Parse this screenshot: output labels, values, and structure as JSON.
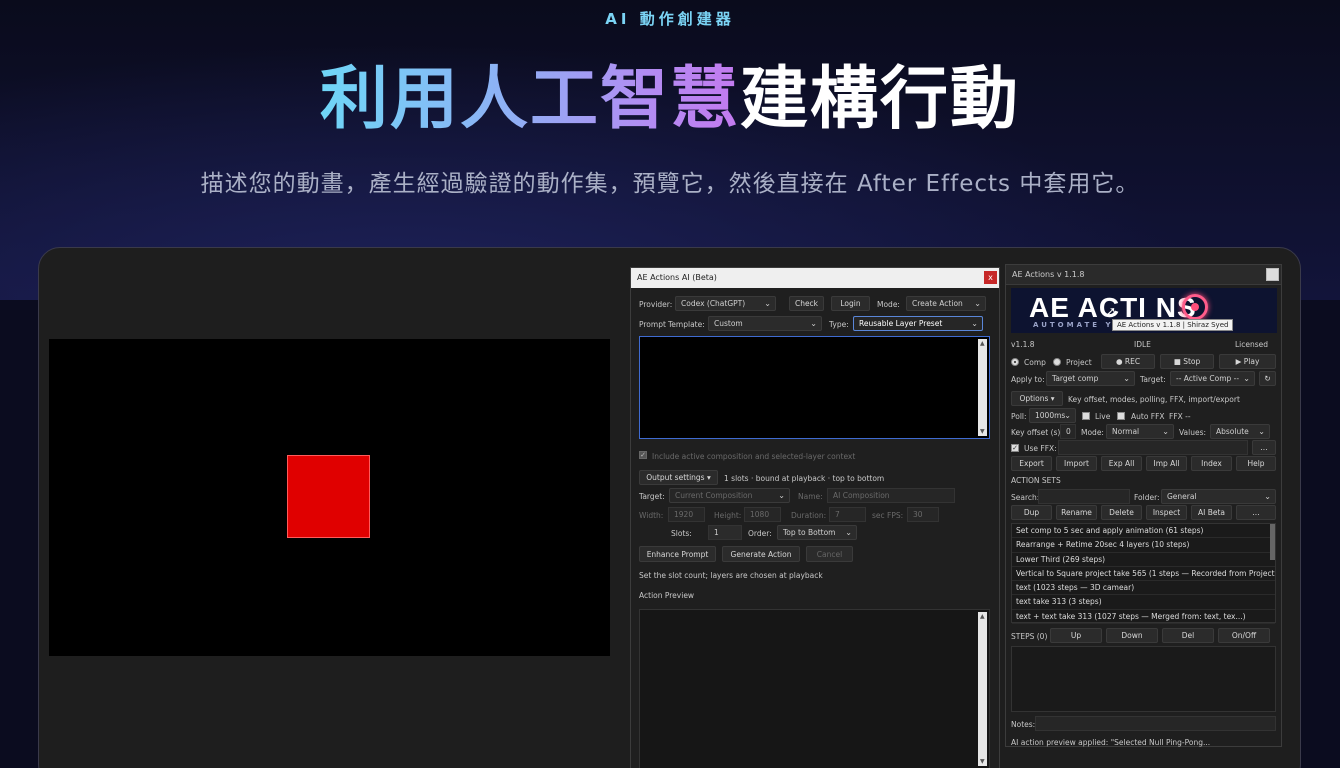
{
  "hero": {
    "eyebrow": "AI 動作創建器",
    "headline_gradient": "利用人工智慧",
    "headline_white": "建構行動",
    "subline": "描述您的動畫，產生經過驗證的動作集，預覽它，然後直接在 After Effects 中套用它。"
  },
  "ai_panel": {
    "title": "AE Actions AI (Beta)",
    "close_label": "x",
    "provider_label": "Provider:",
    "provider_value": "Codex (ChatGPT)",
    "check_label": "Check",
    "login_label": "Login",
    "mode_label": "Mode:",
    "mode_value": "Create Action",
    "prompt_label": "Prompt",
    "template_label": "Template:",
    "template_value": "Custom",
    "type_label": "Type:",
    "type_value": "Reusable Layer Preset",
    "include_context_label": "Include active composition and selected-layer context",
    "output_settings_label": "Output settings ▾",
    "slots_info": "1 slots · bound at playback · top to bottom",
    "target_label": "Target:",
    "target_value": "Current Composition",
    "name_label": "Name:",
    "name_value": "AI Composition",
    "width_label": "Width:",
    "width_value": "1920",
    "height_label": "Height:",
    "height_value": "1080",
    "duration_label": "Duration:",
    "duration_value": "7",
    "sec_fps_label": "sec  FPS:",
    "fps_value": "30",
    "slots_label": "Slots:",
    "slots_value": "1",
    "order_label": "Order:",
    "order_value": "Top to Bottom",
    "enhance_label": "Enhance Prompt",
    "generate_label": "Generate Action",
    "cancel_label": "Cancel",
    "hint_text": "Set the slot count; layers are chosen at playback",
    "preview_label": "Action Preview"
  },
  "actions_panel": {
    "title": "AE Actions v 1.1.8",
    "logo_text": "AE ACTI NS",
    "logo_sub": "AUTOMATE YOU                    LOW",
    "tooltip": "AE Actions v 1.1.8  |  Shiraz Syed",
    "version": "v1.1.8",
    "status": "IDLE",
    "license": "Licensed",
    "comp_label": "Comp",
    "project_label": "Project",
    "rec_label": "● REC",
    "stop_label": "■ Stop",
    "play_label": "▶ Play",
    "apply_to_label": "Apply to:",
    "apply_to_value": "Target comp",
    "target_label": "Target:",
    "target_value": "-- Active Comp --",
    "refresh_label": "↻",
    "options_label": "Options ▾",
    "options_desc": "Key offset, modes, polling, FFX, import/export",
    "poll_label": "Poll:",
    "poll_value": "1000ms",
    "live_label": "Live",
    "auto_ffx_label": "Auto FFX",
    "ffx_status": "FFX --",
    "key_offset_label": "Key offset (s):",
    "key_offset_value": "0",
    "mode_label": "Mode:",
    "mode_value": "Normal",
    "values_label": "Values:",
    "values_value": "Absolute",
    "use_ffx_label": "Use FFX:",
    "ffx_browse": "...",
    "toolbar": [
      "Export",
      "Import",
      "Exp All",
      "Imp All",
      "Index",
      "Help"
    ],
    "action_sets_label": "ACTION SETS",
    "search_label": "Search:",
    "folder_label": "Folder:",
    "folder_value": "General",
    "set_buttons": [
      "Dup",
      "Rename",
      "Delete",
      "Inspect",
      "AI Beta",
      "..."
    ],
    "action_sets": [
      "Set comp to 5 sec and apply animation  (61 steps)",
      "Rearrange + Retime 20sec 4 layers  (10 steps)",
      "Lower Third  (269 steps)",
      "Vertical to Square project take 565  (1 steps  — Recorded from Project ...)",
      "text  (1023 steps  — 3D camear)",
      "text take 313  (3 steps)",
      "text + text take 313  (1027 steps  — Merged from: text, tex...)"
    ],
    "steps_label": "STEPS (0)",
    "step_buttons": [
      "Up",
      "Down",
      "Del",
      "On/Off"
    ],
    "notes_label": "Notes:",
    "status_line": "AI action preview applied: \"Selected Null Ping-Pong..."
  }
}
